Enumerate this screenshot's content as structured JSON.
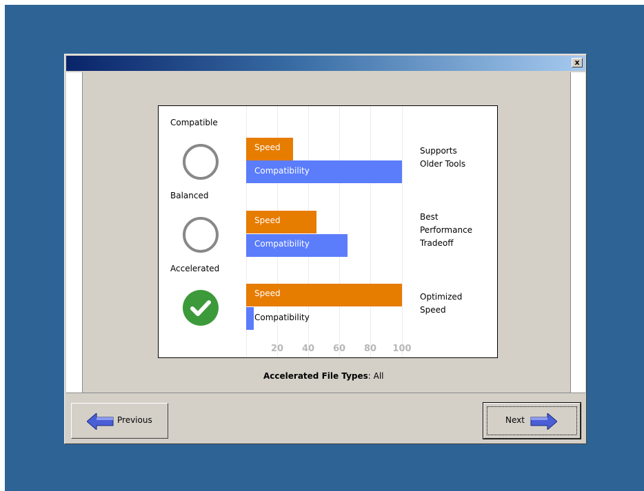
{
  "dialog": {
    "close_label": "x",
    "titlebar_colors": [
      "#0a246a",
      "#a6caf0"
    ]
  },
  "options": [
    {
      "title": "Compatible",
      "selected": false,
      "speed_label": "Speed",
      "compat_label": "Compatibility",
      "speed_value": 30,
      "compat_value": 100,
      "description": [
        "Supports",
        "Older Tools"
      ]
    },
    {
      "title": "Balanced",
      "selected": false,
      "speed_label": "Speed",
      "compat_label": "Compatibility",
      "speed_value": 45,
      "compat_value": 65,
      "description": [
        "Best",
        "Performance",
        "Tradeoff"
      ]
    },
    {
      "title": "Accelerated",
      "selected": true,
      "speed_label": "Speed",
      "compat_label": "Compatibility",
      "speed_value": 100,
      "compat_value": 5,
      "description": [
        "Optimized",
        "Speed"
      ]
    }
  ],
  "axis": {
    "ticks": [
      "20",
      "40",
      "60",
      "80",
      "100"
    ]
  },
  "file_types": {
    "label": "Accelerated File Types",
    "value": ": All"
  },
  "buttons": {
    "previous": "Previous",
    "next": "Next"
  },
  "colors": {
    "speed": "#e67c00",
    "compatibility": "#5b7dfb",
    "selected_check": "#3d9a3a",
    "desktop": "#2e6395"
  }
}
